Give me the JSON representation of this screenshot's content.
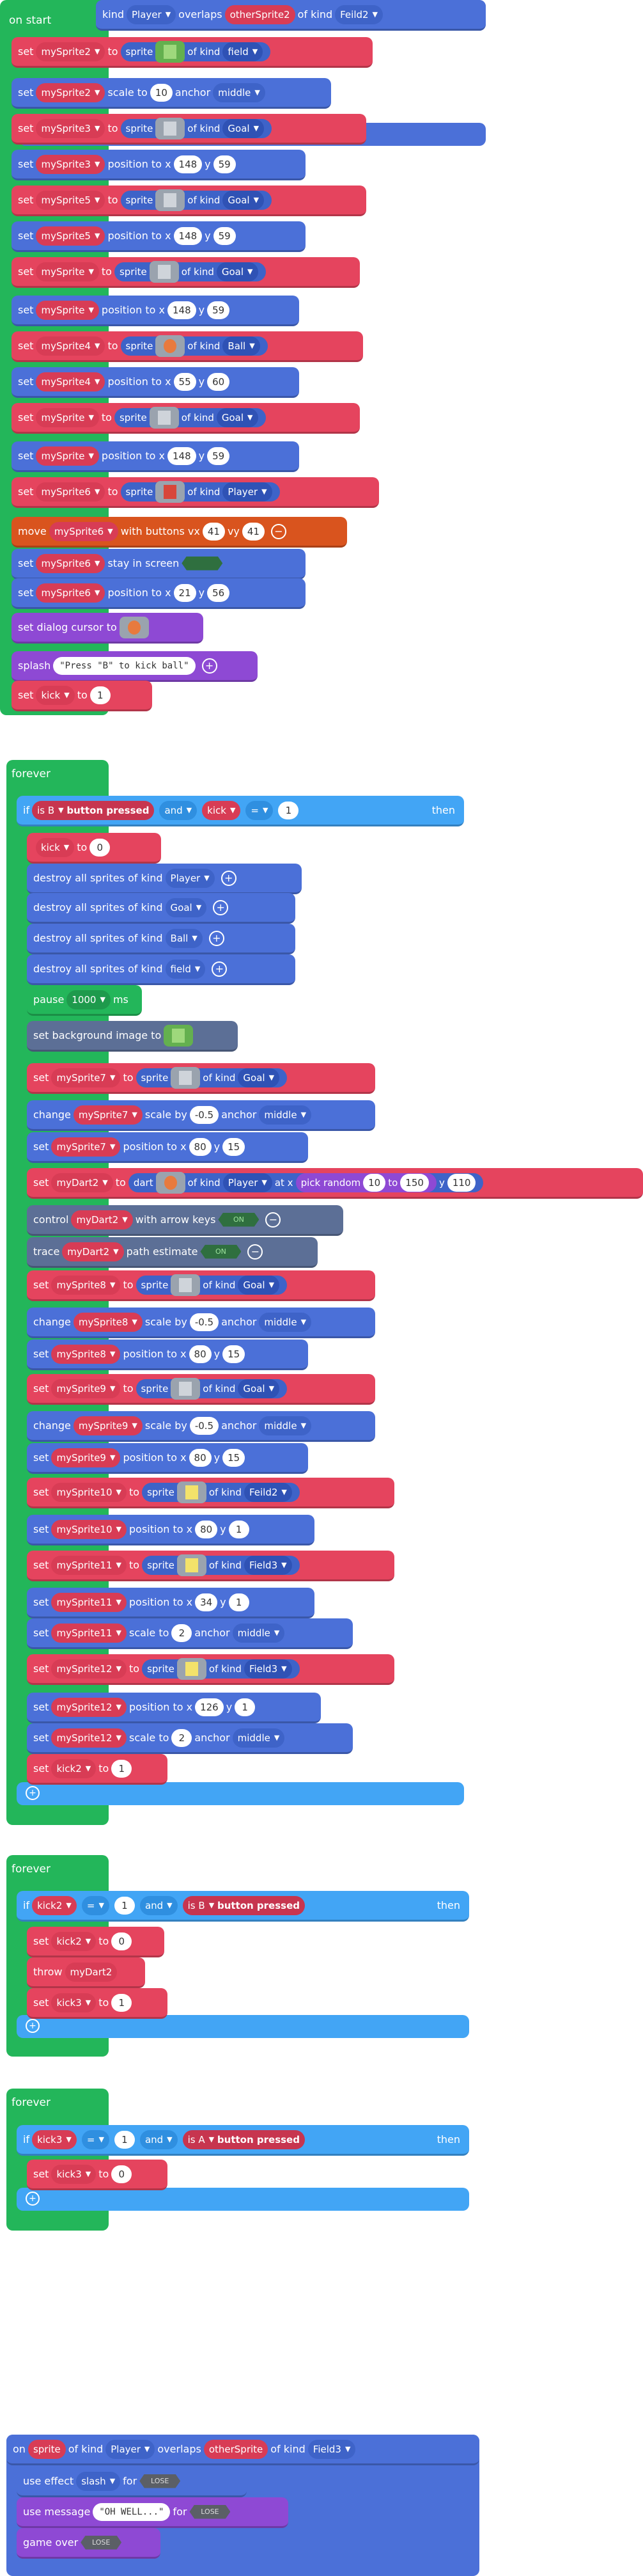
{
  "colors": {
    "set": "#e5445e",
    "sprite": "#4b70d8",
    "logic": "#42a5f5",
    "event": "#23b65a",
    "misc": "#8e49d4"
  },
  "on_start": {
    "overlap_top": {
      "kind": "kind",
      "sprite_kind": "Player",
      "overlaps": "overlaps",
      "other": "otherSprite2",
      "of_kind": "of kind",
      "other_kind": "Feild2"
    },
    "header": "on start",
    "w": {
      "set": "set",
      "to": "to",
      "sprite": "sprite",
      "of_kind": "of kind",
      "scale_to": "scale to",
      "anchor": "anchor",
      "position_to": "position to x",
      "y": "y",
      "move": "move",
      "with_buttons": "with buttons vx",
      "vy": "vy",
      "stay": "stay in screen",
      "dialog": "set dialog cursor to",
      "splash": "splash"
    },
    "v": {
      "ms2": "mySprite2",
      "field": "field",
      "scale": "10",
      "middle": "middle",
      "ms3": "mySprite3",
      "goal": "Goal",
      "x148": "148",
      "y59": "59",
      "ms5": "mySprite5",
      "ms": "mySprite",
      "ms4": "mySprite4",
      "ball": "Ball",
      "x55": "55",
      "y60": "60",
      "ms6": "mySprite6",
      "player": "Player",
      "vx": "41",
      "vy": "41",
      "x21": "21",
      "y56": "56",
      "splash_text": "\"Press \"B\" to kick ball\"",
      "kick": "kick",
      "one": "1"
    }
  },
  "forever1": {
    "header": "forever",
    "w": {
      "if": "if",
      "is": "is",
      "button_pressed": "button pressed",
      "and": "and",
      "eq": "=",
      "then": "then",
      "destroy": "destroy all sprites of kind",
      "pause": "pause",
      "ms_unit": "ms",
      "bg": "set background image to",
      "change": "change",
      "scale_by": "scale by",
      "dart": "dart",
      "at_x": "at x",
      "pick": "pick random",
      "pick_to": "to",
      "control": "control",
      "with_arrows": "with arrow keys",
      "trace": "trace",
      "path": "path estimate"
    },
    "v": {
      "B": "B",
      "kick": "kick",
      "one": "1",
      "zero": "0",
      "player": "Player",
      "goal": "Goal",
      "ball": "Ball",
      "field": "field",
      "pause_ms": "1000",
      "ms7": "mySprite7",
      "neg05": "-0.5",
      "middle": "middle",
      "x80": "80",
      "y15": "15",
      "dart2": "myDart2",
      "r10": "10",
      "r150": "150",
      "y110": "110",
      "ms8": "mySprite8",
      "ms9": "mySprite9",
      "ms10": "mySprite10",
      "feild2": "Feild2",
      "y1": "1",
      "ms11": "mySprite11",
      "field3": "Field3",
      "x34": "34",
      "two": "2",
      "ms12": "mySprite12",
      "x126": "126",
      "kick2": "kick2",
      "on": "ON"
    }
  },
  "forever2": {
    "header": "forever",
    "if": "if",
    "kick2": "kick2",
    "eq": "=",
    "one": "1",
    "and": "and",
    "is": "is",
    "B": "B",
    "button_pressed": "button pressed",
    "then": "then",
    "set": "set",
    "to": "to",
    "zero": "0",
    "throw": "throw",
    "dart": "myDart2",
    "kick3": "kick3"
  },
  "forever3": {
    "header": "forever",
    "if": "if",
    "kick3": "kick3",
    "eq": "=",
    "one": "1",
    "and": "and",
    "is": "is",
    "A": "A",
    "button_pressed": "button pressed",
    "then": "then",
    "set": "set",
    "to": "to",
    "zero": "0"
  },
  "overlap2": {
    "on": "on",
    "sprite": "sprite",
    "of_kind": "of kind",
    "player": "Player",
    "overlaps": "overlaps",
    "other": "otherSprite",
    "field3": "Field3",
    "effect": "use effect",
    "slash": "slash",
    "for": "for",
    "lose": "LOSE",
    "message": "use message",
    "oh_well": "\"OH WELL...\"",
    "game_over": "game over"
  }
}
